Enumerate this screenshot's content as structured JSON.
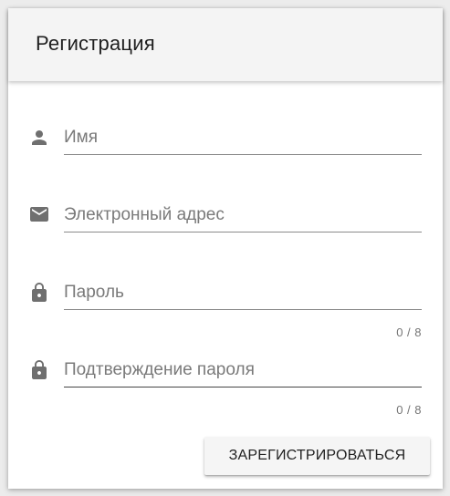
{
  "header": {
    "title": "Регистрация"
  },
  "form": {
    "name": {
      "placeholder": "Имя",
      "value": "",
      "icon": "person-icon"
    },
    "email": {
      "placeholder": "Электронный адрес",
      "value": "",
      "icon": "mail-icon"
    },
    "password": {
      "placeholder": "Пароль",
      "value": "",
      "icon": "lock-icon",
      "counter": "0 / 8"
    },
    "confirm_password": {
      "placeholder": "Подтверждение пароля",
      "value": "",
      "icon": "lock-icon",
      "counter": "0 / 8"
    },
    "submit_label": "ЗАРЕГИСТРИРОВАТЬСЯ"
  },
  "colors": {
    "icon": "#6f6f6f",
    "header_bg": "#f4f4f4",
    "button_bg": "#f5f5f5"
  }
}
